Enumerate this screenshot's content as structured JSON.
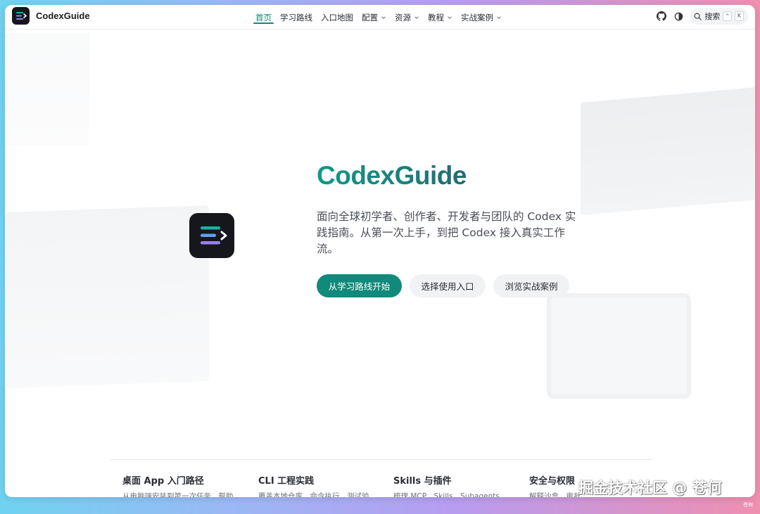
{
  "brand": {
    "name": "CodexGuide"
  },
  "nav": {
    "items": [
      {
        "label": "首页",
        "active": true,
        "dropdown": false
      },
      {
        "label": "学习路线",
        "active": false,
        "dropdown": false
      },
      {
        "label": "入口地图",
        "active": false,
        "dropdown": false
      },
      {
        "label": "配置",
        "active": false,
        "dropdown": true
      },
      {
        "label": "资源",
        "active": false,
        "dropdown": true
      },
      {
        "label": "教程",
        "active": false,
        "dropdown": true
      },
      {
        "label": "实战案例",
        "active": false,
        "dropdown": true
      }
    ],
    "search_label": "搜索",
    "search_keys": [
      "⌃",
      "K"
    ]
  },
  "hero": {
    "title": "CodexGuide",
    "description": "面向全球初学者、创作者、开发者与团队的 Codex 实践指南。从第一次上手，到把 Codex 接入真实工作流。",
    "primary_button": "从学习路线开始",
    "secondary_button_1": "选择使用入口",
    "secondary_button_2": "浏览实战案例"
  },
  "features": [
    {
      "title": "桌面 App 入门路径",
      "subtitle": "从电脑端安装到第一次任务、帮助"
    },
    {
      "title": "CLI 工程实践",
      "subtitle": "覆盖本地仓库、命令执行、测试验"
    },
    {
      "title": "Skills 与插件",
      "subtitle": "梳理 MCP、Skills、Subagents"
    },
    {
      "title": "安全与权限",
      "subtitle": "解释沙盒、审批"
    }
  ],
  "watermark": {
    "text": "掘金技术社区 @ 苍何",
    "small": "苍何"
  },
  "colors": {
    "accent": "#11897b",
    "dark_icon": "#16171c"
  }
}
